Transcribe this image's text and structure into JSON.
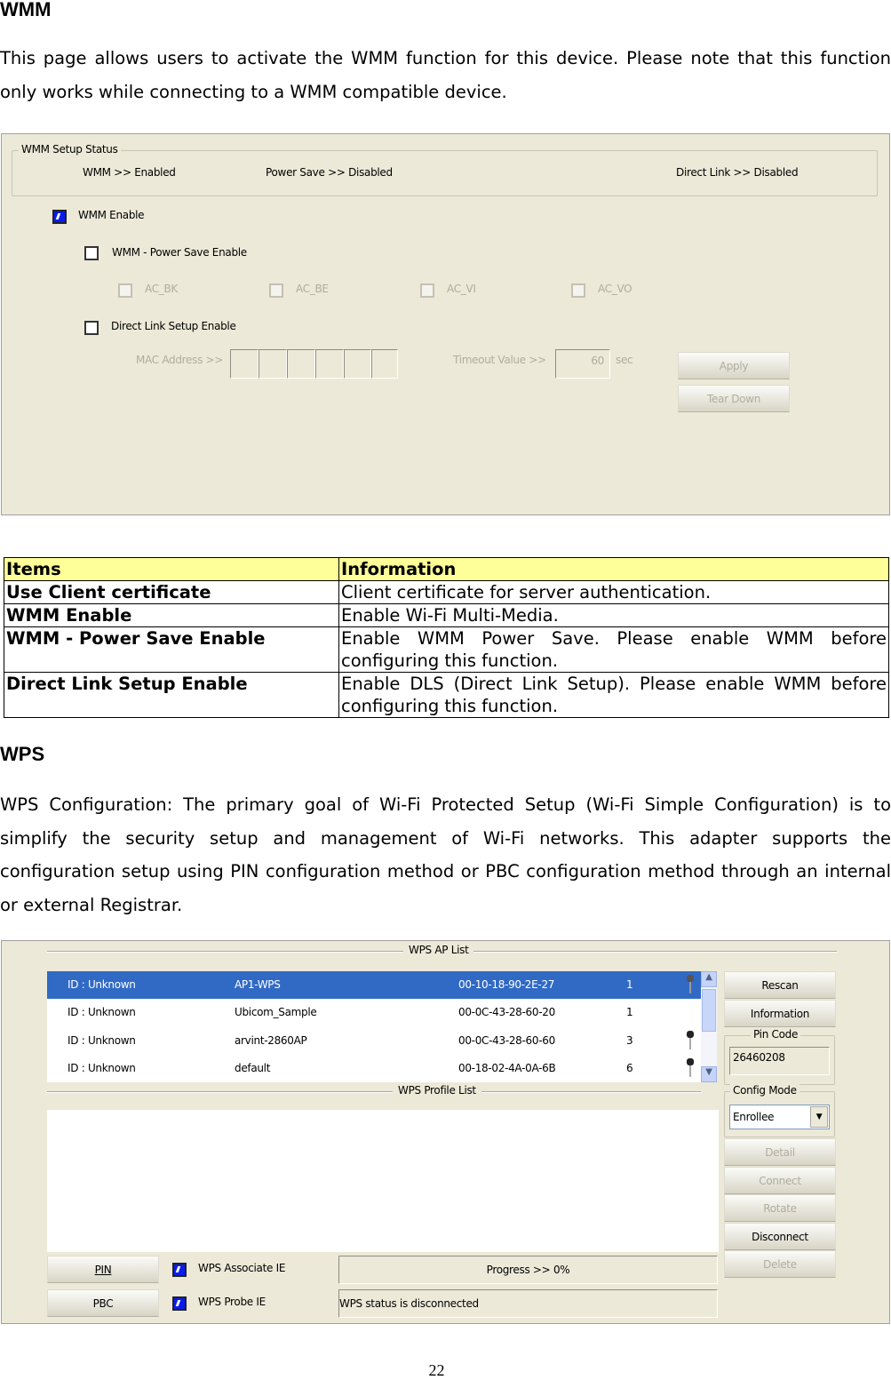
{
  "wmm": {
    "heading": "WMM",
    "intro": "This page allows users to activate the WMM function for this device. Please note that this function only works while connecting to a WMM compatible device.",
    "panel": {
      "status_legend": "WMM Setup Status",
      "status_wmm": "WMM >> Enabled",
      "status_power_save": "Power Save >> Disabled",
      "status_direct_link": "Direct Link >> Disabled",
      "wmm_enable": {
        "label": "WMM Enable",
        "checked": true
      },
      "power_save_enable": {
        "label": "WMM - Power Save Enable",
        "checked": false
      },
      "ac": [
        {
          "label": "AC_BK",
          "checked": false
        },
        {
          "label": "AC_BE",
          "checked": false
        },
        {
          "label": "AC_VI",
          "checked": false
        },
        {
          "label": "AC_VO",
          "checked": false
        }
      ],
      "direct_link_enable": {
        "label": "Direct Link Setup Enable",
        "checked": false
      },
      "mac_label": "MAC Address >>",
      "timeout_label": "Timeout Value >>",
      "timeout_value": "60",
      "timeout_unit": "sec",
      "apply": "Apply",
      "tear_down": "Tear Down"
    }
  },
  "table": {
    "headers": [
      "Items",
      "Information"
    ],
    "rows": [
      [
        "Use Client certificate",
        "Client certificate for server authentication."
      ],
      [
        "WMM Enable",
        "Enable Wi-Fi Multi-Media."
      ],
      [
        "WMM - Power Save Enable",
        "Enable WMM Power Save. Please enable WMM before configuring this function."
      ],
      [
        "Direct Link Setup Enable",
        "Enable DLS (Direct Link Setup). Please enable WMM before configuring this function."
      ]
    ]
  },
  "wps": {
    "heading": "WPS",
    "intro": "WPS Configuration: The primary goal of Wi-Fi Protected Setup (Wi-Fi Simple Configuration) is to simplify the security setup and management of Wi-Fi networks. This adapter supports the configuration setup using PIN configuration method or PBC configuration method through an internal or external Registrar.",
    "panel": {
      "ap_list_legend": "WPS AP List",
      "profile_list_legend": "WPS Profile List",
      "ap_list": [
        {
          "id": "ID : Unknown",
          "ssid": "AP1-WPS",
          "bssid": "00-10-18-90-2E-27",
          "channel": "1",
          "secured": true,
          "selected": true
        },
        {
          "id": "ID : Unknown",
          "ssid": "Ubicom_Sample",
          "bssid": "00-0C-43-28-60-20",
          "channel": "1",
          "secured": false
        },
        {
          "id": "ID : Unknown",
          "ssid": "arvint-2860AP",
          "bssid": "00-0C-43-28-60-60",
          "channel": "3",
          "secured": true
        },
        {
          "id": "ID : Unknown",
          "ssid": "default",
          "bssid": "00-18-02-4A-0A-6B",
          "channel": "6",
          "secured": true
        }
      ],
      "rescan": "Rescan",
      "information": "Information",
      "pin_code_legend": "Pin Code",
      "pin_code": "26460208",
      "config_mode_legend": "Config Mode",
      "config_mode": "Enrollee",
      "detail": "Detail",
      "connect": "Connect",
      "rotate": "Rotate",
      "disconnect": "Disconnect",
      "delete": "Delete",
      "pin": "PIN",
      "pbc": "PBC",
      "associate_ie": {
        "label": "WPS Associate IE",
        "checked": true
      },
      "probe_ie": {
        "label": "WPS Probe IE",
        "checked": true
      },
      "progress": "Progress >> 0%",
      "progress_percent": 0,
      "status": "WPS status is disconnected"
    }
  },
  "page_number": "22",
  "colors": {
    "selection": "#316ac5",
    "table_header": "#ffff99",
    "panel_bg": "#ece9d8"
  }
}
